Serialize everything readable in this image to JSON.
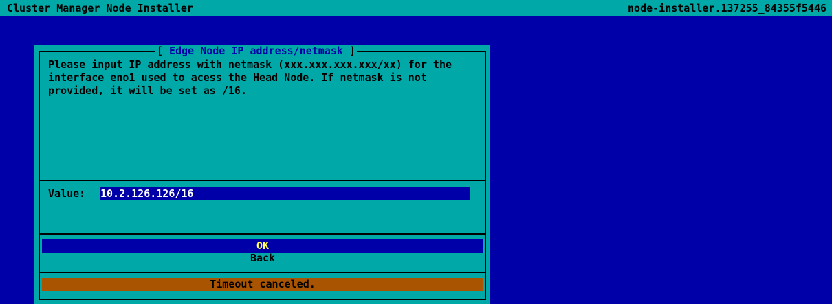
{
  "header": {
    "app_title": "Cluster Manager Node Installer",
    "host_id": "node-installer.137255_84355f5446"
  },
  "dialog": {
    "title_open": "[",
    "title": " Edge Node IP address/netmask ",
    "title_close": "]",
    "message_lines": [
      "Please input IP address with netmask (xxx.xxx.xxx.xxx/xx) for the",
      "interface eno1 used to acess the Head Node. If netmask is not",
      "provided, it will be set as /16."
    ],
    "value_label": "Value:",
    "value": "10.2.126.126/16",
    "ok_label": "OK",
    "back_label": "Back",
    "status": "Timeout canceled."
  },
  "colors": {
    "background": "#0000a8",
    "panel": "#00a8a8",
    "highlight_text": "#ffff55",
    "status_bar": "#a85400"
  }
}
